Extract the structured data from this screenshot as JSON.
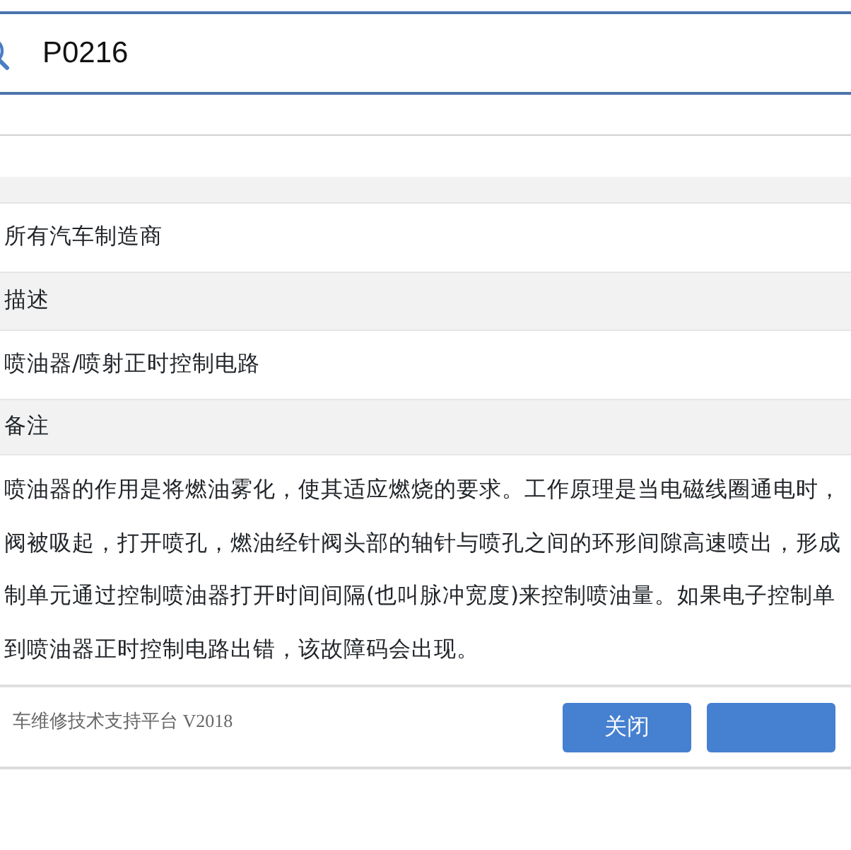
{
  "search": {
    "value": "P0216"
  },
  "sections": [
    {
      "kind": "header"
    },
    {
      "kind": "value",
      "lines": [
        "所有汽车制造商"
      ]
    },
    {
      "kind": "header",
      "text": "描述"
    },
    {
      "kind": "value",
      "lines": [
        "喷油器/喷射正时控制电路"
      ]
    },
    {
      "kind": "header",
      "text": "备注"
    },
    {
      "kind": "paragraph",
      "lines": [
        "喷油器的作用是将燃油雾化，使其适应燃烧的要求。工作原理是当电磁线圈通电时，",
        "阀被吸起，打开喷孔，燃油经针阀头部的轴针与喷孔之间的环形间隙高速喷出，形成",
        "制单元通过控制喷油器打开时间间隔(也叫脉冲宽度)来控制喷油量。如果电子控制单",
        "到喷油器正时控制电路出错，该故障码会出现。"
      ]
    }
  ],
  "footer": {
    "text": "车维修技术支持平台 V2018",
    "buttons": [
      {
        "kind": "labeled",
        "label": "关闭"
      },
      {
        "kind": "blank"
      }
    ]
  }
}
